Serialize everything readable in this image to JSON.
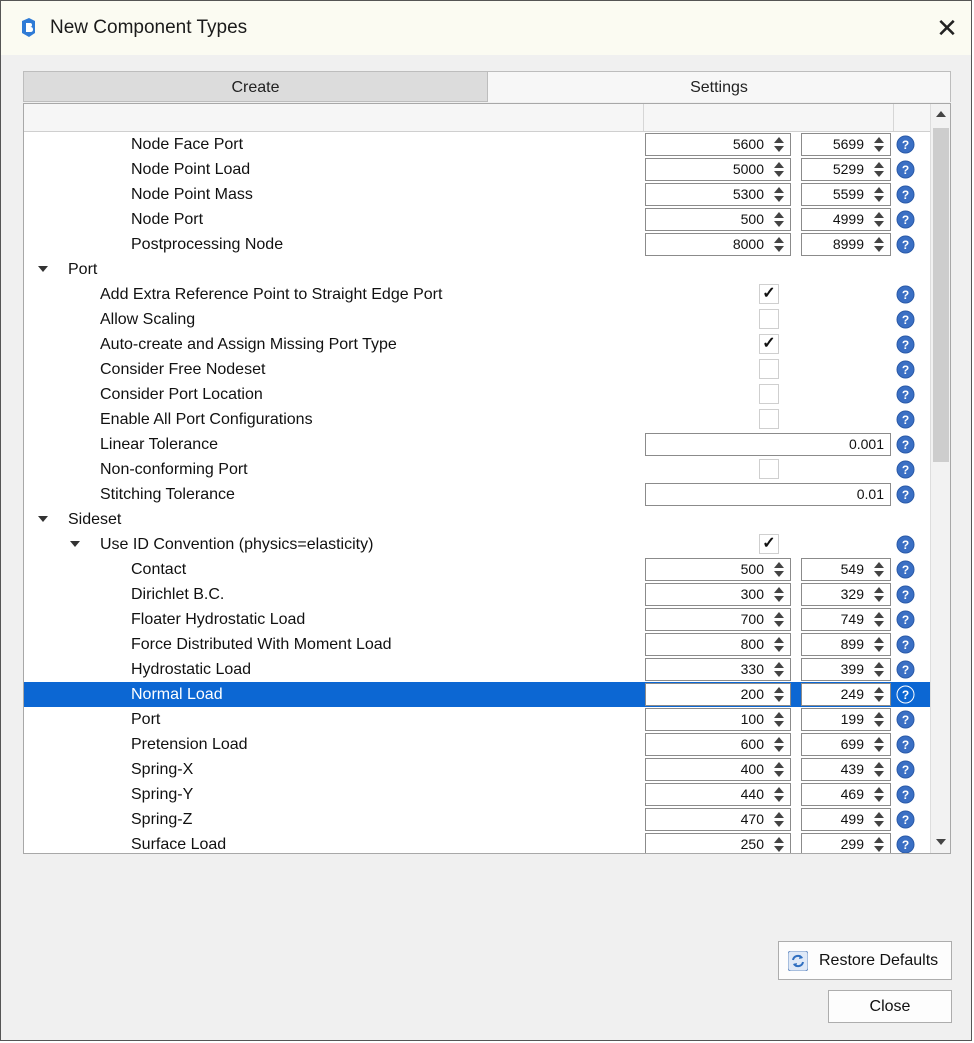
{
  "window": {
    "title": "New Component Types",
    "close_label": "✕"
  },
  "tabs": [
    {
      "label": "Create"
    },
    {
      "label": "Settings"
    }
  ],
  "colors": {
    "selection": "#0c67d3",
    "help_icon": "#3a6fc4",
    "window_bg": "#f0f0f0"
  },
  "rows": [
    {
      "label": "Node Face Port",
      "indent": 4,
      "kind": "range",
      "from": "5600",
      "to": "5699"
    },
    {
      "label": "Node Point Load",
      "indent": 4,
      "kind": "range",
      "from": "5000",
      "to": "5299"
    },
    {
      "label": "Node Point Mass",
      "indent": 4,
      "kind": "range",
      "from": "5300",
      "to": "5599"
    },
    {
      "label": "Node Port",
      "indent": 4,
      "kind": "range",
      "from": "500",
      "to": "4999"
    },
    {
      "label": "Postprocessing Node",
      "indent": 4,
      "kind": "range",
      "from": "8000",
      "to": "8999"
    },
    {
      "label": "Port",
      "indent": 1,
      "kind": "group",
      "expanded": true
    },
    {
      "label": "Add Extra Reference Point to Straight Edge Port",
      "indent": 3,
      "kind": "check",
      "checked": true
    },
    {
      "label": "Allow Scaling",
      "indent": 3,
      "kind": "check",
      "checked": false
    },
    {
      "label": "Auto-create and Assign Missing Port Type",
      "indent": 3,
      "kind": "check",
      "checked": true
    },
    {
      "label": "Consider Free Nodeset",
      "indent": 3,
      "kind": "check",
      "checked": false
    },
    {
      "label": "Consider Port Location",
      "indent": 3,
      "kind": "check",
      "checked": false
    },
    {
      "label": "Enable All Port Configurations",
      "indent": 3,
      "kind": "check",
      "checked": false
    },
    {
      "label": "Linear Tolerance",
      "indent": 3,
      "kind": "text",
      "value": "0.001"
    },
    {
      "label": "Non-conforming Port",
      "indent": 3,
      "kind": "check",
      "checked": false
    },
    {
      "label": "Stitching Tolerance",
      "indent": 3,
      "kind": "text",
      "value": "0.01"
    },
    {
      "label": "Sideset",
      "indent": 1,
      "kind": "group",
      "expanded": true
    },
    {
      "label": "Use ID Convention (physics=elasticity)",
      "indent": 2,
      "kind": "groupcheck",
      "checked": true,
      "expanded": true
    },
    {
      "label": "Contact",
      "indent": 4,
      "kind": "range",
      "from": "500",
      "to": "549"
    },
    {
      "label": "Dirichlet B.C.",
      "indent": 4,
      "kind": "range",
      "from": "300",
      "to": "329"
    },
    {
      "label": "Floater Hydrostatic Load",
      "indent": 4,
      "kind": "range",
      "from": "700",
      "to": "749"
    },
    {
      "label": "Force Distributed With Moment Load",
      "indent": 4,
      "kind": "range",
      "from": "800",
      "to": "899"
    },
    {
      "label": "Hydrostatic Load",
      "indent": 4,
      "kind": "range",
      "from": "330",
      "to": "399"
    },
    {
      "label": "Normal Load",
      "indent": 4,
      "kind": "range",
      "from": "200",
      "to": "249",
      "selected": true
    },
    {
      "label": "Port",
      "indent": 4,
      "kind": "range",
      "from": "100",
      "to": "199"
    },
    {
      "label": "Pretension Load",
      "indent": 4,
      "kind": "range",
      "from": "600",
      "to": "699"
    },
    {
      "label": "Spring-X",
      "indent": 4,
      "kind": "range",
      "from": "400",
      "to": "439"
    },
    {
      "label": "Spring-Y",
      "indent": 4,
      "kind": "range",
      "from": "440",
      "to": "469"
    },
    {
      "label": "Spring-Z",
      "indent": 4,
      "kind": "range",
      "from": "470",
      "to": "499"
    },
    {
      "label": "Surface Load",
      "indent": 4,
      "kind": "range",
      "from": "250",
      "to": "299"
    }
  ],
  "buttons": {
    "restore_defaults": "Restore Defaults",
    "close": "Close"
  },
  "icons": {
    "app": "app-logo-icon",
    "help": "help-icon",
    "restore": "refresh-icon"
  }
}
